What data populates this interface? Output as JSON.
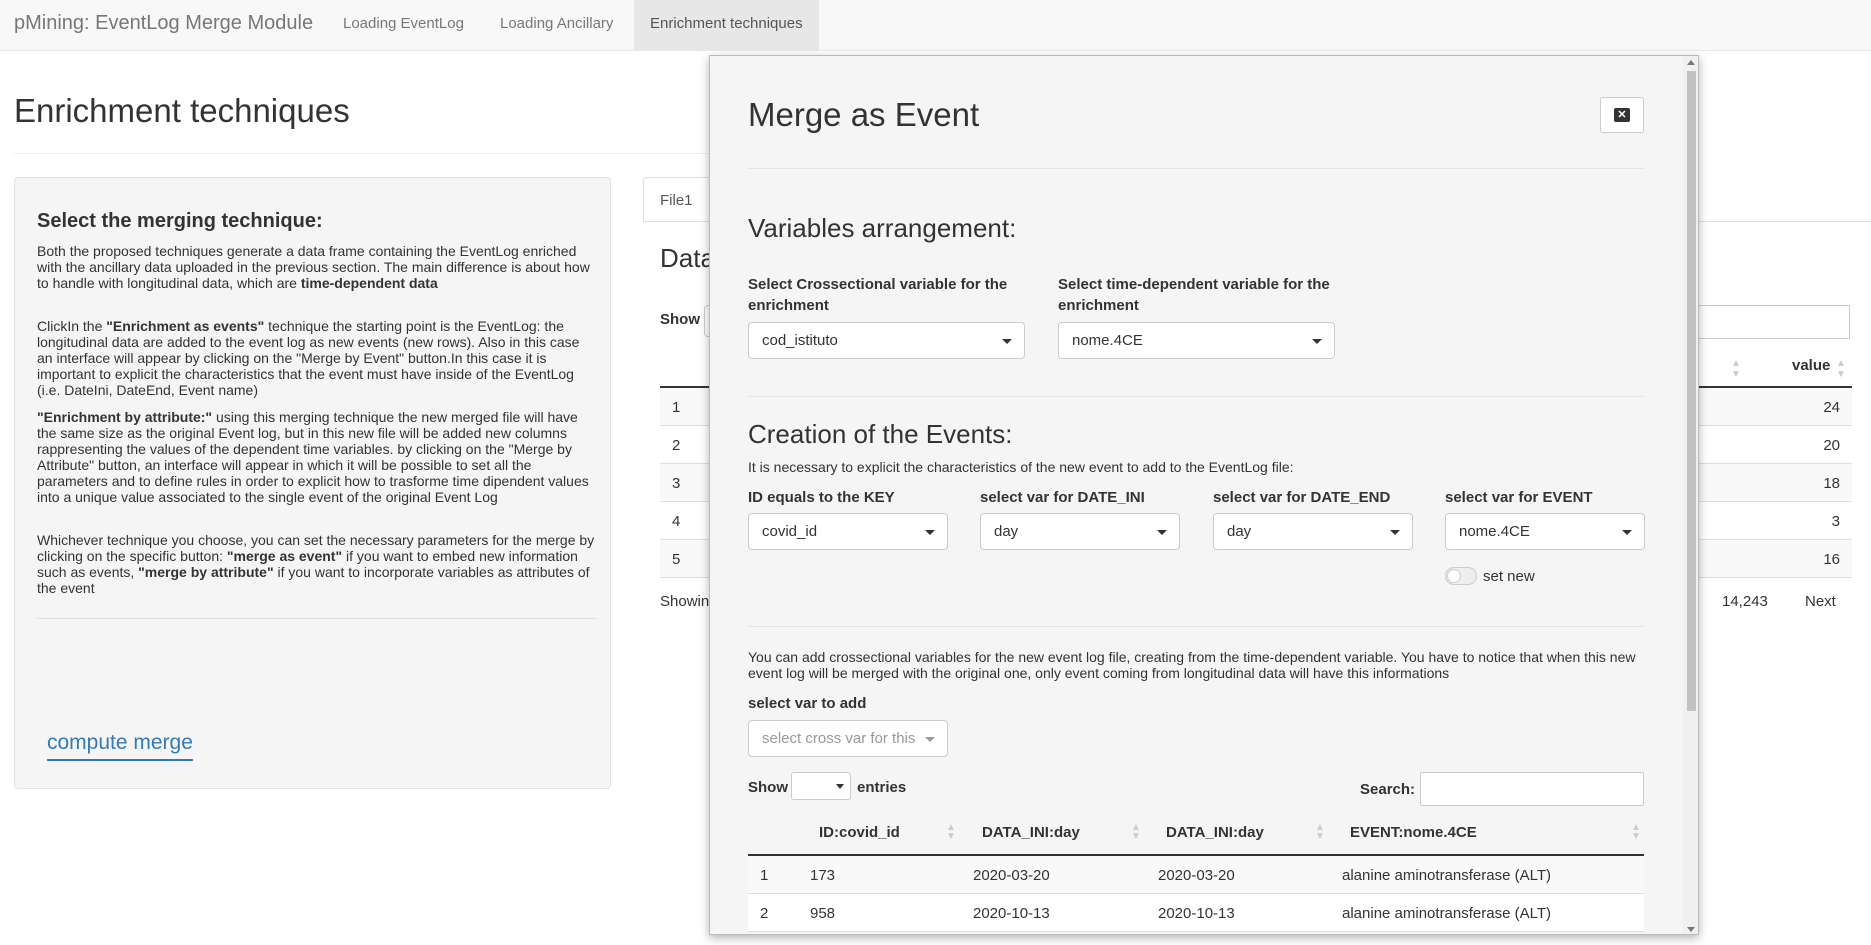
{
  "navbar": {
    "brand": "pMining: EventLog Merge Module",
    "tabs": [
      {
        "label": "Loading EventLog",
        "active": false
      },
      {
        "label": "Loading Ancillary",
        "active": false
      },
      {
        "label": "Enrichment techniques",
        "active": true
      }
    ]
  },
  "page": {
    "title": "Enrichment techniques",
    "sidebar": {
      "heading": "Select the merging technique:",
      "p1_a": "Both the proposed techniques generate a data frame containing the EventLog enriched with the ancillary data uploaded in the previous section. The main difference is about how to handle with longitudinal data, which are ",
      "p1_b": "time-dependent data",
      "p2_a": "ClickIn the ",
      "p2_b": "\"Enrichment as events\"",
      "p2_c": " technique the starting point is the EventLog: the longitudinal data are added to the event log as new events (new rows). Also in this case an interface will appear by clicking on the \"Merge by Event\" button.In this case it is important to explicit the characteristics that the event must have inside of the EventLog (i.e. DateIni, DateEnd, Event name)",
      "p3_a": "\"Enrichment by attribute:\"",
      "p3_b": " using this merging technique the new merged file will have the same size as the original Event log, but in this new file will be added new columns rappresenting the values of the dependent time variables. by clicking on the \"Merge by Attribute\" button, an interface will appear in which it will be possible to set all the parameters and to define rules in order to explicit how to trasforme time dipendent values into a unique value associated to the single event of the original Event Log",
      "p4_a": "Whichever technique you choose, you can set the necessary parameters for the merge by clicking on the specific button: ",
      "p4_b": "\"merge as event\"",
      "p4_c": " if you want to embed new information such as events, ",
      "p4_d": "\"merge by attribute\"",
      "p4_e": " if you want to incorporate variables as attributes of the event",
      "compute_button": "compute merge"
    },
    "main": {
      "tab": "File1",
      "heading_partial": "Data",
      "show_label": "Show",
      "col_value": "value",
      "rows": [
        {
          "n": "1",
          "value": "24"
        },
        {
          "n": "2",
          "value": "20"
        },
        {
          "n": "3",
          "value": "18"
        },
        {
          "n": "4",
          "value": "3"
        },
        {
          "n": "5",
          "value": "16"
        }
      ],
      "showing_partial": "Showin",
      "total": "14,243",
      "next": "Next"
    }
  },
  "modal": {
    "title": "Merge as Event",
    "section1": {
      "heading": "Variables arrangement:",
      "cross_label": "Select Crossectional variable for the enrichment",
      "cross_value": "cod_istituto",
      "time_label": "Select time-dependent variable for the enrichment",
      "time_value": "nome.4CE"
    },
    "section2": {
      "heading": "Creation of the Events:",
      "note": "It is necessary to explicit the characteristics of the new event to add to the EventLog file:",
      "id_label": "ID equals to the KEY",
      "id_value": "covid_id",
      "ini_label": "select var for DATE_INI",
      "ini_value": "day",
      "end_label": "select var for DATE_END",
      "end_value": "day",
      "event_label": "select var for EVENT",
      "event_value": "nome.4CE",
      "toggle_label": "set new"
    },
    "section3": {
      "note": "You can add crossectional variables for the new event log file, creating from the time-dependent variable. You have to notice that when this new event log will be merged with the original one, only event coming from longitudinal data will have this informations",
      "add_label": "select var to add",
      "add_placeholder": "select cross var for this"
    },
    "table": {
      "show_label": "Show",
      "entries_label": "entries",
      "search_label": "Search:",
      "columns": [
        "ID:covid_id",
        "DATA_INI:day",
        "DATA_INI:day",
        "EVENT:nome.4CE"
      ],
      "rows": [
        {
          "n": "1",
          "id": "173",
          "ini": "2020-03-20",
          "ini2": "2020-03-20",
          "event": "alanine aminotransferase (ALT)"
        },
        {
          "n": "2",
          "id": "958",
          "ini": "2020-10-13",
          "ini2": "2020-10-13",
          "event": "alanine aminotransferase (ALT)"
        }
      ]
    }
  },
  "colors": {
    "link": "#337ab7",
    "navbar_bg": "#f8f8f8",
    "well_bg": "#f5f5f5"
  }
}
